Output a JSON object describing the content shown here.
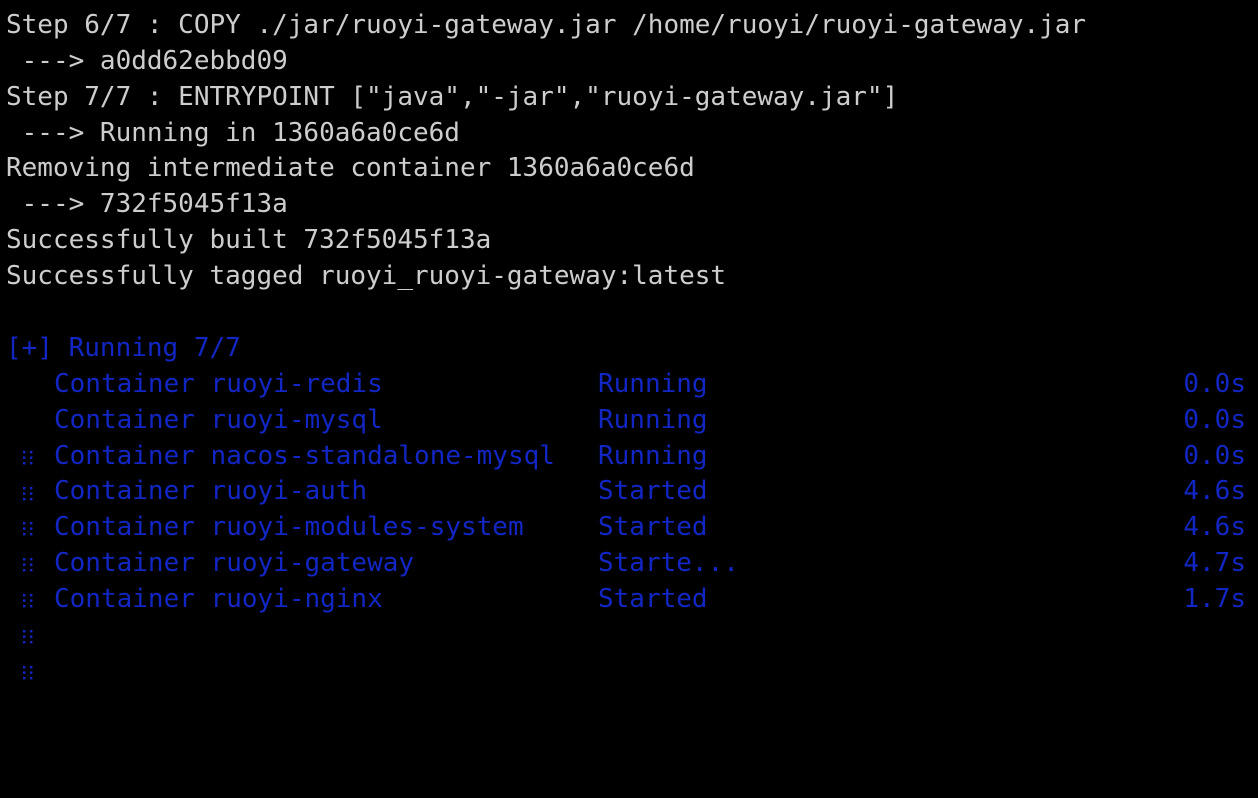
{
  "terminal": {
    "background_color": "#000000",
    "foreground_color": "#cdcdcd",
    "accent_color": "#1226c4",
    "build_log_lines": [
      "Step 6/7 : COPY ./jar/ruoyi-gateway.jar /home/ruoyi/ruoyi-gateway.jar",
      " ---> a0dd62ebbd09",
      "Step 7/7 : ENTRYPOINT [\"java\",\"-jar\",\"ruoyi-gateway.jar\"]",
      " ---> Running in 1360a6a0ce6d",
      "Removing intermediate container 1360a6a0ce6d",
      " ---> 732f5045f13a",
      "Successfully built 732f5045f13a",
      "Successfully tagged ruoyi_ruoyi-gateway:latest"
    ],
    "compose": {
      "header": "[+] Running 7/7",
      "handle_icon": "drag-handle-dots-icon",
      "row_prefix": "Container",
      "rows": [
        {
          "name": "ruoyi-redis",
          "status": "Running",
          "time": "0.0s"
        },
        {
          "name": "ruoyi-mysql",
          "status": "Running",
          "time": "0.0s"
        },
        {
          "name": "nacos-standalone-mysql",
          "status": "Running",
          "time": "0.0s"
        },
        {
          "name": "ruoyi-auth",
          "status": "Started",
          "time": "4.6s"
        },
        {
          "name": "ruoyi-modules-system",
          "status": "Started",
          "time": "4.6s"
        },
        {
          "name": "ruoyi-gateway",
          "status": "Starte...",
          "time": "4.7s"
        },
        {
          "name": "ruoyi-nginx",
          "status": "Started",
          "time": "1.7s"
        }
      ]
    }
  }
}
